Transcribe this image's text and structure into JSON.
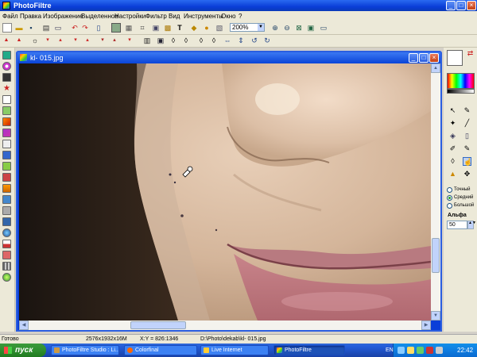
{
  "app": {
    "title": "PhotoFiltre",
    "window_buttons": {
      "minimize": "_",
      "maximize": "□",
      "close": "×"
    }
  },
  "menu": [
    "Файл",
    "Правка",
    "Изображение",
    "Выделенное",
    "Настройки",
    "Фильтр",
    "Вид",
    "Инструменты",
    "Окно",
    "?"
  ],
  "toolbar": {
    "zoom_value": "200%",
    "zoom_options": [
      "200%"
    ]
  },
  "document": {
    "title": "kl- 015.jpg",
    "buttons": {
      "minimize": "_",
      "maximize": "□",
      "close": "×"
    }
  },
  "right_panel": {
    "size_options": [
      "Точный",
      "Средний",
      "Большой"
    ],
    "selected_size": "Средний",
    "alpha_label": "Альфа",
    "alpha_value": "50"
  },
  "status": {
    "ready": "Готово",
    "dimensions": "2576x1932x16M",
    "coordinates": "X:Y = 826:1346",
    "filepath": "D:\\Photo\\dekab\\kl- 015.jpg"
  },
  "taskbar": {
    "start_label": "пуск",
    "tasks": [
      {
        "label": "PhotoFiltre Studio : Li...",
        "active": false
      },
      {
        "label": "Colorfinal",
        "active": false
      },
      {
        "label": "Live Internet",
        "active": false
      },
      {
        "label": "PhotoFiltre",
        "active": true
      }
    ],
    "language": "EN",
    "clock": "22:42"
  },
  "colors": {
    "xp_blue": "#0a3ed8",
    "xp_face": "#ece9d8",
    "start_green": "#2f8f2f",
    "foreground": "#ffffff",
    "background": "#000000"
  }
}
